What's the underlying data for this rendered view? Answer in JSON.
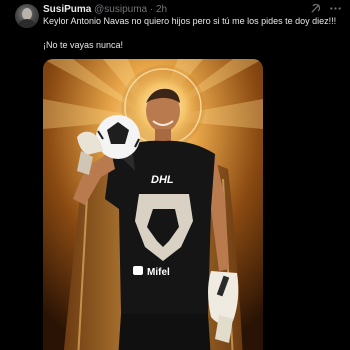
{
  "tweet": {
    "display_name": "SusiPuma",
    "handle": "@susipuma",
    "separator": "·",
    "time": "2h",
    "text_line1": "Keylor Antonio Navas no quiero hijos pero si tú me los pides te doy diez!!!",
    "text_line2": "¡No te vayas nunca!"
  },
  "actions": {
    "grok_icon": "grok-icon",
    "more_icon": "more-options-icon"
  },
  "media": {
    "jersey_sponsor_top": "DHL",
    "jersey_sponsor_bottom": "Mifel",
    "description_icons": [
      "halo",
      "soccer-ball",
      "goalkeeper-glove"
    ]
  },
  "colors": {
    "background": "#000000",
    "text_primary": "#e7e9ea",
    "text_secondary": "#71767b",
    "gold": "#d89a3a"
  }
}
